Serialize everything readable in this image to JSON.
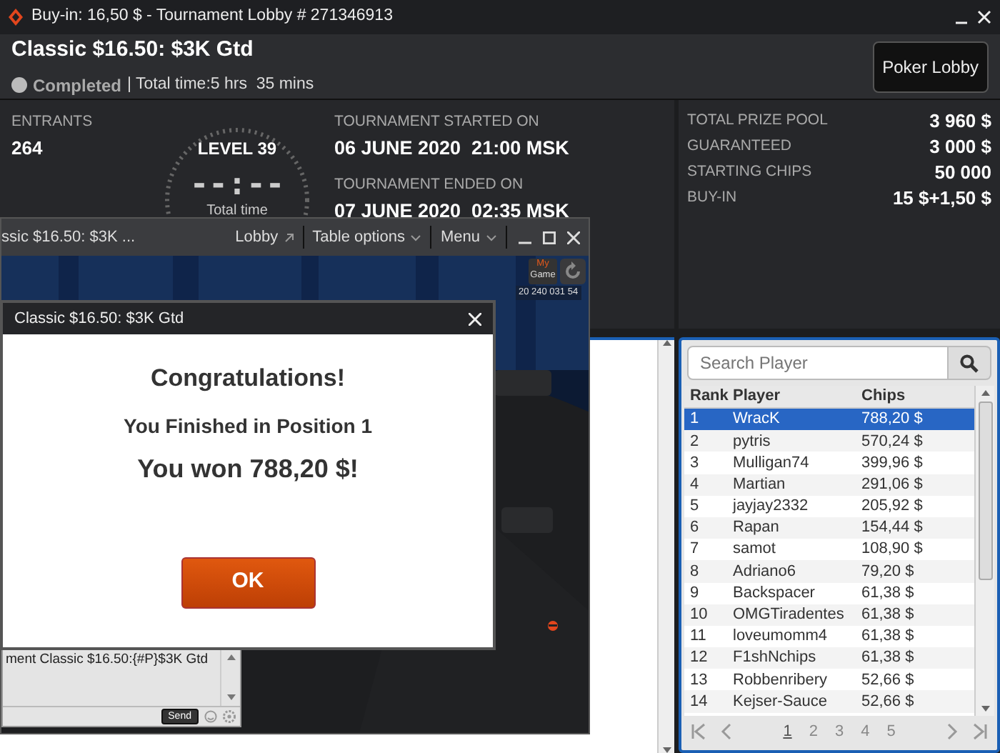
{
  "window": {
    "title": "Buy-in: 16,50 $ - Tournament Lobby # 271346913"
  },
  "header": {
    "title": "Classic $16.50: $3K Gtd",
    "status": "Completed",
    "total_time": "| Total time:5 hrs  35 mins",
    "button": "Poker Lobby"
  },
  "info": {
    "entrants_label": "ENTRANTS",
    "entrants": "264",
    "level": "LEVEL 39",
    "clock": "--:--",
    "clock_label": "Total time",
    "started_label": "TOURNAMENT STARTED ON",
    "started": "06 JUNE 2020  21:00 MSK",
    "ended_label": "TOURNAMENT ENDED ON",
    "ended": "07 JUNE 2020  02:35 MSK"
  },
  "prize": [
    {
      "label": "TOTAL PRIZE POOL",
      "value": "3 960 $"
    },
    {
      "label": "GUARANTEED",
      "value": "3 000 $"
    },
    {
      "label": "STARTING CHIPS",
      "value": "50 000"
    },
    {
      "label": "BUY-IN",
      "value": "15 $+1,50 $"
    }
  ],
  "table_window": {
    "title": "ssic $16.50: $3K ...",
    "links": [
      {
        "label": "Lobby",
        "kind": "external"
      },
      {
        "label": "Table options",
        "kind": "dropdown"
      },
      {
        "label": "Menu",
        "kind": "dropdown"
      }
    ],
    "my": "My",
    "game": "Game",
    "counter": "20 240 031 54",
    "chat_line": "ment Classic $16.50:{#P}$3K Gtd",
    "send": "Send"
  },
  "dialog": {
    "title": "Classic $16.50: $3K Gtd",
    "heading": "Congratulations!",
    "line": "You Finished in Position 1",
    "prize": "You won 788,20 $!",
    "button": "OK"
  },
  "players": {
    "search_placeholder": "Search Player",
    "columns": [
      "Rank",
      "Player",
      "Chips"
    ],
    "rows": [
      {
        "rank": "1",
        "player": "WracK",
        "chips": "788,20 $",
        "selected": true
      },
      {
        "rank": "2",
        "player": "pytris",
        "chips": "570,24 $",
        "selected": false
      },
      {
        "rank": "3",
        "player": "Mulligan74",
        "chips": "399,96 $",
        "selected": false
      },
      {
        "rank": "4",
        "player": "Martian",
        "chips": "291,06 $",
        "selected": false
      },
      {
        "rank": "5",
        "player": "jayjay2332",
        "chips": "205,92 $",
        "selected": false
      },
      {
        "rank": "6",
        "player": "Rapan",
        "chips": "154,44 $",
        "selected": false
      },
      {
        "rank": "7",
        "player": "samot",
        "chips": "108,90 $",
        "selected": false
      },
      {
        "rank": "8",
        "player": "Adriano6",
        "chips": "79,20 $",
        "selected": false
      },
      {
        "rank": "9",
        "player": "Backspacer",
        "chips": "61,38 $",
        "selected": false
      },
      {
        "rank": "10",
        "player": "OMGTiradentes",
        "chips": "61,38 $",
        "selected": false
      },
      {
        "rank": "11",
        "player": "loveumomm4",
        "chips": "61,38 $",
        "selected": false
      },
      {
        "rank": "12",
        "player": "F1shNchips",
        "chips": "61,38 $",
        "selected": false
      },
      {
        "rank": "13",
        "player": "Robbenribery",
        "chips": "52,66 $",
        "selected": false
      },
      {
        "rank": "14",
        "player": "Kejser-Sauce",
        "chips": "52,66 $",
        "selected": false
      }
    ],
    "pages": [
      {
        "label": "1",
        "selected": true
      },
      {
        "label": "2",
        "selected": false
      },
      {
        "label": "3",
        "selected": false
      },
      {
        "label": "4",
        "selected": false
      },
      {
        "label": "5",
        "selected": false
      }
    ]
  }
}
